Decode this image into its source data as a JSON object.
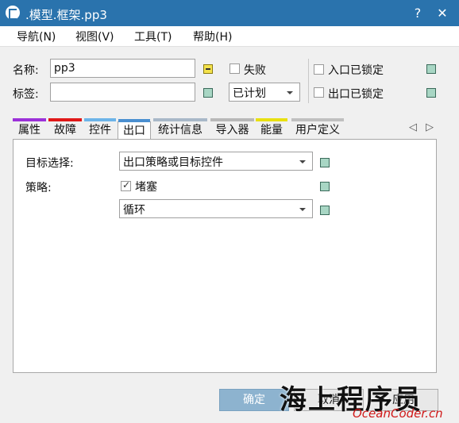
{
  "window": {
    "title": ".模型.框架.pp3",
    "help_btn": "?",
    "close_btn": "✕"
  },
  "menu": [
    "导航(N)",
    "视图(V)",
    "工具(T)",
    "帮助(H)"
  ],
  "form": {
    "name_label": "名称:",
    "name_value": "pp3",
    "tag_label": "标签:",
    "tag_value": "",
    "failed_label": "失败",
    "status_value": "已计划",
    "entry_locked_label": "入口已锁定",
    "exit_locked_label": "出口已锁定"
  },
  "tabs": [
    {
      "label": "属性",
      "color": "#9b30d8"
    },
    {
      "label": "故障",
      "color": "#e01818"
    },
    {
      "label": "控件",
      "color": "#6cb4e8"
    },
    {
      "label": "出口",
      "color": "#4a8fd0",
      "active": true
    },
    {
      "label": "统计信息",
      "color": "#a8b8c8"
    },
    {
      "label": "导入器",
      "color": "#b8b8b8"
    },
    {
      "label": "能量",
      "color": "#e8e010"
    },
    {
      "label": "用户定义",
      "color": "#c0c0c0"
    }
  ],
  "tab_scroll": {
    "left": "◁",
    "right": "▷"
  },
  "exit_panel": {
    "target_label": "目标选择:",
    "target_value": "出口策略或目标控件",
    "strategy_label": "策略:",
    "blocked_label": "堵塞",
    "loop_value": "循环"
  },
  "buttons": {
    "ok": "确定",
    "cancel": "取消",
    "apply": "应用"
  },
  "watermark": {
    "text": "海上程序员",
    "url": "OceanCoder.cn"
  }
}
